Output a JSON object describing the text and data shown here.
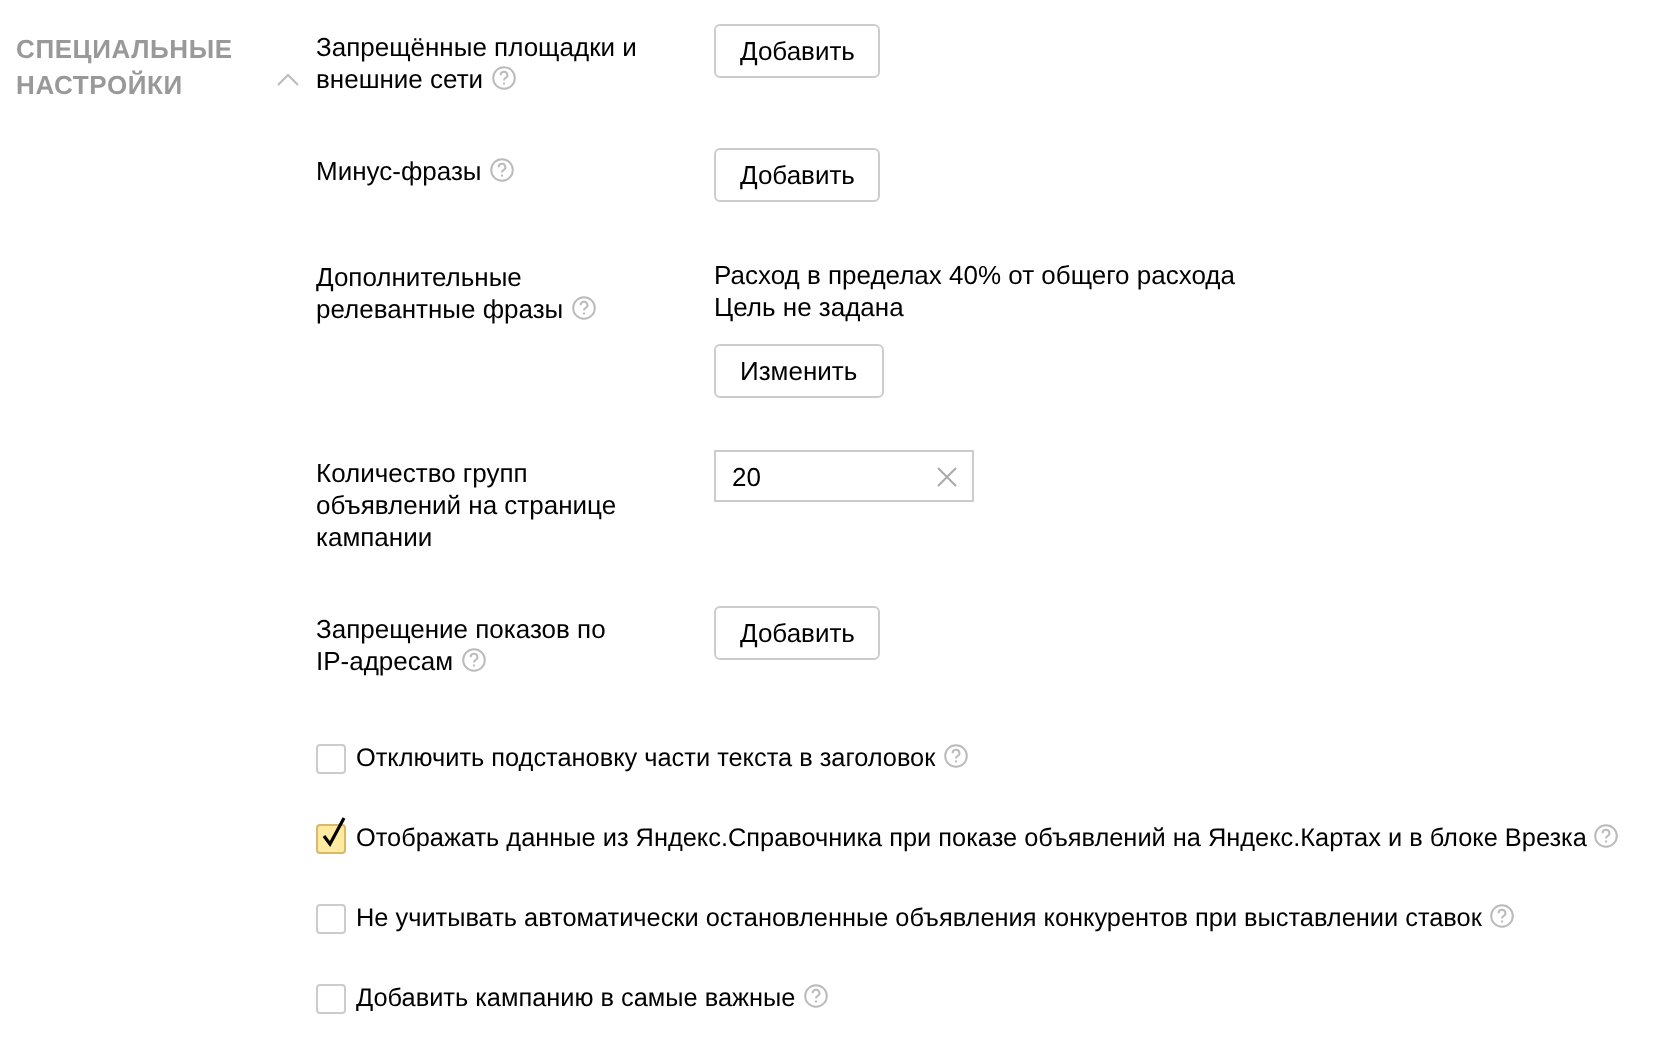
{
  "section": {
    "title": "СПЕЦИАЛЬНЫЕ НАСТРОЙКИ",
    "expanded": true
  },
  "settings": [
    {
      "kind": "button",
      "label": "Запрещённые площадки и внешние сети",
      "help": true,
      "button": "Добавить"
    },
    {
      "kind": "button",
      "label": "Минус-фразы",
      "help": true,
      "button": "Добавить"
    },
    {
      "kind": "info",
      "label": "Дополнительные релевантные фразы",
      "help": true,
      "lines": [
        "Расход в пределах 40% от общего расхода",
        "Цель не задана"
      ],
      "button": "Изменить"
    },
    {
      "kind": "input",
      "label": "Количество групп объявлений на странице кампании",
      "help": false,
      "value": "20"
    },
    {
      "kind": "button",
      "label": "Запрещение показов по IP-адресам",
      "help": true,
      "button": "Добавить"
    }
  ],
  "options": [
    {
      "label": "Отключить подстановку части текста в заголовок",
      "checked": false
    },
    {
      "label": "Отображать данные из Яндекс.Справочника при показе объявлений на Яндекс.Картах и в блоке Врезка",
      "checked": true
    },
    {
      "label": "Не учитывать автоматически остановленные объявления конкурентов при выставлении ставок",
      "checked": false
    },
    {
      "label": "Добавить кампанию в самые важные",
      "checked": false
    }
  ]
}
